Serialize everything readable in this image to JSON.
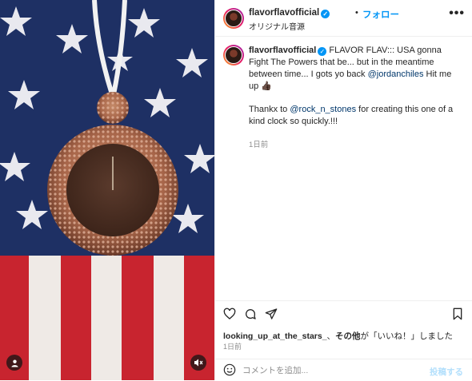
{
  "post": {
    "username": "flavorflavofficial",
    "follow_label": "フォロー",
    "dot": "•",
    "audio_label": "オリジナル音源",
    "more_label": "•••"
  },
  "caption": {
    "username": "flavorflavofficial",
    "line1_text": "FLAVOR FLAV::: USA gonna Fight The Powers that be... but in the meantime between time... I gots yo back",
    "mention1": "@jordanchiles",
    "line1_tail": "Hit me up",
    "emoji": "👍🏿",
    "line2_head": "Thankx to",
    "mention2": "@rock_n_stones",
    "line2_tail": "for creating this one of a kind clock so quickly.!!!",
    "time": "1日前"
  },
  "engagement": {
    "liked_by_user": "looking_up_at_the_stars_",
    "liked_sep": "、",
    "others_label": "その他",
    "likes_suffix": "が「いいね！」しました",
    "time": "1日前"
  },
  "comment_box": {
    "placeholder": "コメントを追加...",
    "post_label": "投稿する"
  },
  "icons": {
    "heart": "heart-icon",
    "comment": "comment-icon",
    "share": "share-icon",
    "save": "bookmark-icon",
    "emoji": "emoji-icon",
    "mute": "sound-off-icon",
    "tag": "user-tag-icon"
  },
  "colors": {
    "accent": "#0095f6",
    "mention": "#00376b",
    "muted": "#8e8e8e"
  }
}
